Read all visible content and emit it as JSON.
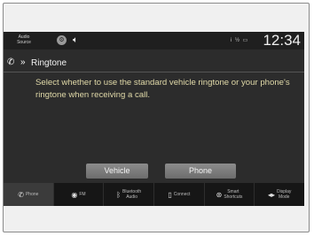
{
  "status_bar": {
    "audio_source_line1": "Audio",
    "audio_source_line2": "Source",
    "indicators": "i ½ ▭",
    "clock": "12:34",
    "icons": [
      "settings-circle-icon",
      "speaker-icon"
    ]
  },
  "header": {
    "title": "Ringtone",
    "icons": [
      "phone-icon",
      "double-chevron-right-icon"
    ]
  },
  "message": "Select whether to use the standard vehicle ringtone or your phone's ringtone when receiving a call.",
  "buttons": {
    "vehicle": "Vehicle",
    "phone": "Phone"
  },
  "bottom_nav": [
    {
      "label": "Phone",
      "label2": "",
      "icon": "phone-icon"
    },
    {
      "label": "FM",
      "label2": "",
      "icon": "radio-icon"
    },
    {
      "label": "Bluetooth",
      "label2": "Audio",
      "icon": "bluetooth-icon"
    },
    {
      "label": "Connect",
      "label2": "",
      "icon": "smartphone-icon"
    },
    {
      "label": "Smart",
      "label2": "Shortcuts",
      "icon": "shortcuts-icon"
    },
    {
      "label": "Display",
      "label2": "Mode",
      "icon": "display-mode-icon"
    }
  ],
  "colors": {
    "screen_bg": "#2c2c2c",
    "message_text": "#e0d9a8",
    "button_bg": "#7d7d7d"
  }
}
